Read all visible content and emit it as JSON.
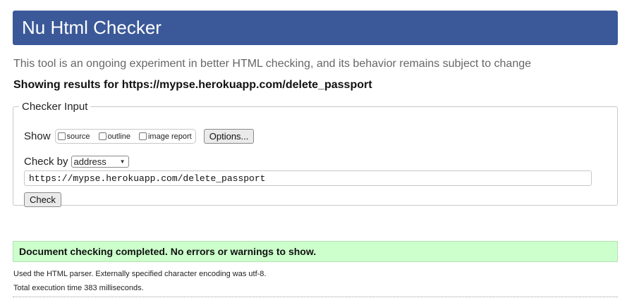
{
  "header": {
    "title": "Nu Html Checker"
  },
  "intro_text": "This tool is an ongoing experiment in better HTML checking, and its behavior remains subject to change",
  "results_for": "Showing results for https://mypse.herokuapp.com/delete_passport",
  "checker_input": {
    "legend": "Checker Input",
    "show_label": "Show",
    "show_options": [
      "source",
      "outline",
      "image report"
    ],
    "options_button": "Options...",
    "check_by_label": "Check by",
    "check_by_selected": "address",
    "url_value": "https://mypse.herokuapp.com/delete_passport",
    "check_button": "Check"
  },
  "result": {
    "message": "Document checking completed. No errors or warnings to show.",
    "parser_info": "Used the HTML parser. Externally specified character encoding was utf-8.",
    "execution_time": "Total execution time 383 milliseconds."
  },
  "colors": {
    "header_bg": "#3b5998",
    "success_bg": "#ccffcc"
  }
}
